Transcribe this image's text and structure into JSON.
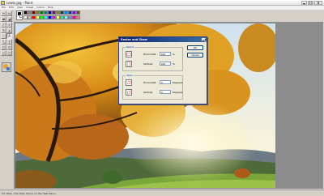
{
  "window": {
    "title": "Lewis.jpg - Paint",
    "controls": [
      "minimize",
      "maximize",
      "close"
    ]
  },
  "menu": [
    "File",
    "Edit",
    "View",
    "Image",
    "Colors",
    "Help"
  ],
  "palette": {
    "foreground": "#000000",
    "background": "#ffffff",
    "colors": [
      "#000000",
      "#808080",
      "#800000",
      "#808000",
      "#008000",
      "#008080",
      "#000080",
      "#800080",
      "#808040",
      "#004040",
      "#0080ff",
      "#004080",
      "#8000ff",
      "#804000",
      "#ffffff",
      "#c0c0c0",
      "#ff0000",
      "#ffff00",
      "#00ff00",
      "#00ffff",
      "#0000ff",
      "#ff00ff",
      "#ffff80",
      "#00ff80",
      "#80ffff",
      "#8080ff",
      "#ff0080",
      "#ff8040"
    ]
  },
  "tools": [
    "free-select",
    "select",
    "eraser",
    "fill",
    "pick-color",
    "magnifier",
    "pencil",
    "brush",
    "airbrush",
    "text",
    "line",
    "curve",
    "rectangle",
    "polygon",
    "ellipse",
    "rounded-rect"
  ],
  "status": {
    "text": "For Help, click Help Topics on the Help Menu."
  },
  "dialog": {
    "title": "Resize and Skew",
    "resize": {
      "label": "Resize",
      "horizontal_label": "Horizontal:",
      "horizontal_value": "100",
      "horizontal_unit": "%",
      "vertical_label": "Vertical:",
      "vertical_value": "100",
      "vertical_unit": "%"
    },
    "skew": {
      "label": "Skew",
      "horizontal_label": "Horizontal:",
      "horizontal_value": "0",
      "horizontal_unit": "Degrees",
      "vertical_label": "Vertical:",
      "vertical_value": "0",
      "vertical_unit": "Degrees"
    },
    "ok_label": "OK",
    "cancel_label": "Cancel"
  }
}
